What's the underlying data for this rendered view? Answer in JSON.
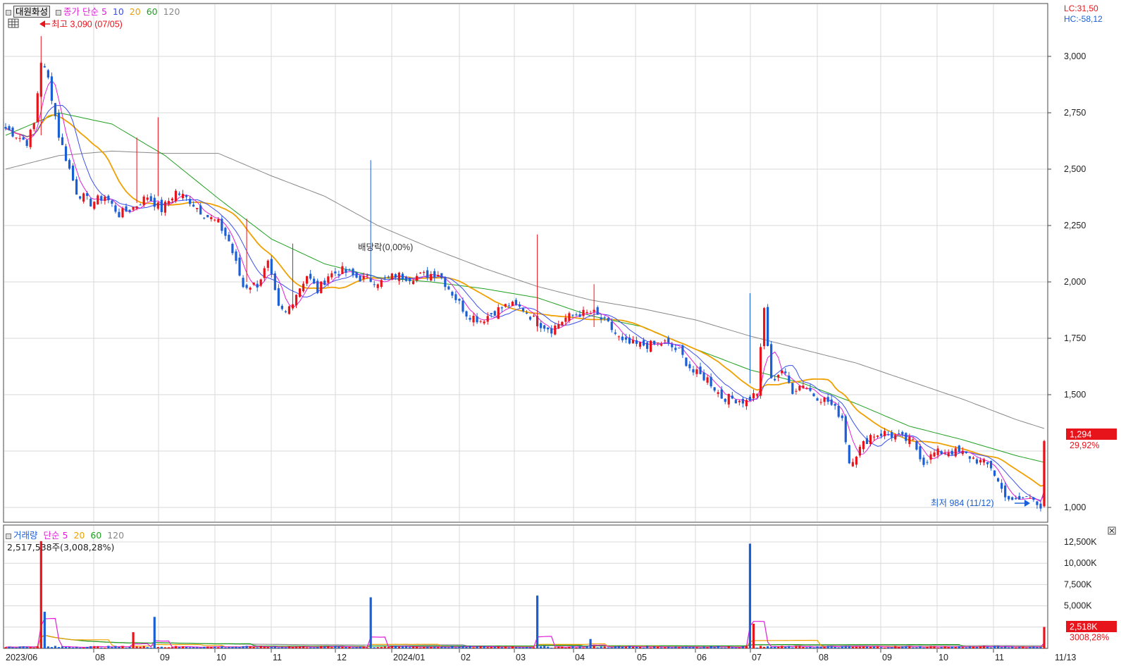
{
  "header": {
    "stock_name": "대원화성",
    "ma_label": "종가 단순",
    "ma_periods": [
      "5",
      "10",
      "20",
      "60",
      "120"
    ],
    "lc": "LC:31,50",
    "hc": "HC:-58,12",
    "high_marker": "최고 3,090 (07/05)",
    "low_marker": "최저 984 (11/12)",
    "dividend": "배당락(0,00%)",
    "last_price": "1,294",
    "last_change": "29,92%"
  },
  "volume_header": {
    "label": "거래량",
    "ma_label": "단순",
    "ma_periods": [
      "5",
      "20",
      "60",
      "120"
    ],
    "current": "2,517,538주(3,008,28%)",
    "last_volume": "2,518K",
    "last_volume_change": "3008,28%"
  },
  "colors": {
    "up": "#e8141b",
    "down": "#1a5fd6",
    "ma5": "#e020d8",
    "ma10": "#3a4ef0",
    "ma20": "#f0a000",
    "ma60": "#20a020",
    "ma120": "#888888"
  },
  "chart_data": [
    {
      "type": "candlestick",
      "title": "대원화성",
      "x_ticks": [
        "2023/06",
        "08",
        "09",
        "10",
        "11",
        "12",
        "2024/01",
        "02",
        "03",
        "04",
        "05",
        "06",
        "07",
        "08",
        "09",
        "10",
        "11",
        "11/13"
      ],
      "y_ticks": [
        "3,000",
        "2,750",
        "2,500",
        "2,250",
        "2,000",
        "1,750",
        "1,500",
        "1,000"
      ],
      "ylim": [
        900,
        3150
      ],
      "grid": true,
      "price_path": [
        [
          0,
          2680
        ],
        [
          3,
          2650
        ],
        [
          6,
          2620
        ],
        [
          8,
          2700
        ],
        [
          10,
          2980
        ],
        [
          12,
          2900
        ],
        [
          13,
          2820
        ],
        [
          15,
          2650
        ],
        [
          17,
          2550
        ],
        [
          20,
          2400
        ],
        [
          24,
          2350
        ],
        [
          28,
          2380
        ],
        [
          32,
          2300
        ],
        [
          36,
          2330
        ],
        [
          40,
          2380
        ],
        [
          44,
          2320
        ],
        [
          48,
          2400
        ],
        [
          52,
          2360
        ],
        [
          56,
          2300
        ],
        [
          60,
          2260
        ],
        [
          63,
          2180
        ],
        [
          67,
          1980
        ],
        [
          71,
          1990
        ],
        [
          74,
          2080
        ],
        [
          77,
          1880
        ],
        [
          79,
          1860
        ],
        [
          82,
          1950
        ],
        [
          85,
          2030
        ],
        [
          88,
          1960
        ],
        [
          91,
          2030
        ],
        [
          95,
          2050
        ],
        [
          99,
          2020
        ],
        [
          103,
          2010
        ],
        [
          106,
          2000
        ],
        [
          110,
          2030
        ],
        [
          114,
          2020
        ],
        [
          118,
          2030
        ],
        [
          122,
          2040
        ],
        [
          126,
          1950
        ],
        [
          130,
          1860
        ],
        [
          134,
          1830
        ],
        [
          138,
          1870
        ],
        [
          142,
          1900
        ],
        [
          146,
          1880
        ],
        [
          150,
          1820
        ],
        [
          154,
          1790
        ],
        [
          158,
          1840
        ],
        [
          162,
          1860
        ],
        [
          166,
          1860
        ],
        [
          170,
          1810
        ],
        [
          174,
          1730
        ],
        [
          178,
          1720
        ],
        [
          182,
          1720
        ],
        [
          186,
          1730
        ],
        [
          190,
          1690
        ],
        [
          194,
          1600
        ],
        [
          198,
          1570
        ],
        [
          202,
          1490
        ],
        [
          206,
          1480
        ],
        [
          209,
          1470
        ],
        [
          212,
          1510
        ],
        [
          214,
          1880
        ],
        [
          216,
          1560
        ],
        [
          219,
          1610
        ],
        [
          222,
          1520
        ],
        [
          225,
          1550
        ],
        [
          228,
          1500
        ],
        [
          232,
          1470
        ],
        [
          236,
          1400
        ],
        [
          238,
          1200
        ],
        [
          241,
          1260
        ],
        [
          244,
          1320
        ],
        [
          248,
          1330
        ],
        [
          252,
          1310
        ],
        [
          256,
          1290
        ],
        [
          259,
          1200
        ],
        [
          262,
          1240
        ],
        [
          266,
          1250
        ],
        [
          270,
          1240
        ],
        [
          274,
          1210
        ],
        [
          278,
          1180
        ],
        [
          281,
          1080
        ],
        [
          284,
          1020
        ],
        [
          287,
          1040
        ],
        [
          290,
          1050
        ],
        [
          292,
          1000
        ],
        [
          293,
          1294
        ]
      ],
      "ma_paths": {
        "ma60": [
          [
            0,
            2650
          ],
          [
            15,
            2750
          ],
          [
            30,
            2700
          ],
          [
            45,
            2560
          ],
          [
            60,
            2370
          ],
          [
            75,
            2190
          ],
          [
            90,
            2080
          ],
          [
            105,
            2020
          ],
          [
            120,
            2000
          ],
          [
            135,
            1970
          ],
          [
            150,
            1930
          ],
          [
            165,
            1850
          ],
          [
            180,
            1800
          ],
          [
            195,
            1700
          ],
          [
            210,
            1610
          ],
          [
            225,
            1550
          ],
          [
            240,
            1460
          ],
          [
            255,
            1360
          ],
          [
            270,
            1300
          ],
          [
            285,
            1230
          ],
          [
            293,
            1200
          ]
        ],
        "ma120": [
          [
            0,
            2500
          ],
          [
            15,
            2560
          ],
          [
            30,
            2580
          ],
          [
            45,
            2570
          ],
          [
            60,
            2570
          ],
          [
            75,
            2470
          ],
          [
            90,
            2380
          ],
          [
            105,
            2250
          ],
          [
            120,
            2150
          ],
          [
            135,
            2060
          ],
          [
            150,
            1980
          ],
          [
            165,
            1920
          ],
          [
            180,
            1880
          ],
          [
            195,
            1830
          ],
          [
            210,
            1760
          ],
          [
            225,
            1700
          ],
          [
            240,
            1640
          ],
          [
            255,
            1560
          ],
          [
            270,
            1480
          ],
          [
            285,
            1390
          ],
          [
            293,
            1350
          ]
        ]
      },
      "high": {
        "value": 3090,
        "date": "07/05"
      },
      "low": {
        "value": 984,
        "date": "11/12"
      },
      "last": {
        "value": 1294,
        "change_pct": 29.92
      }
    },
    {
      "type": "bar",
      "title": "거래량",
      "y_ticks": [
        "12,500K",
        "10,000K",
        "7,500K",
        "5,000K"
      ],
      "ylim": [
        0,
        14000
      ],
      "spikes": [
        [
          10,
          12600
        ],
        [
          11,
          4300
        ],
        [
          36,
          1900
        ],
        [
          42,
          3700
        ],
        [
          103,
          6000
        ],
        [
          150,
          6200
        ],
        [
          165,
          1100
        ],
        [
          210,
          12300
        ],
        [
          211,
          2900
        ],
        [
          293,
          2518
        ]
      ],
      "last": {
        "value_k": 2518,
        "change_pct": 3008.28
      }
    }
  ]
}
